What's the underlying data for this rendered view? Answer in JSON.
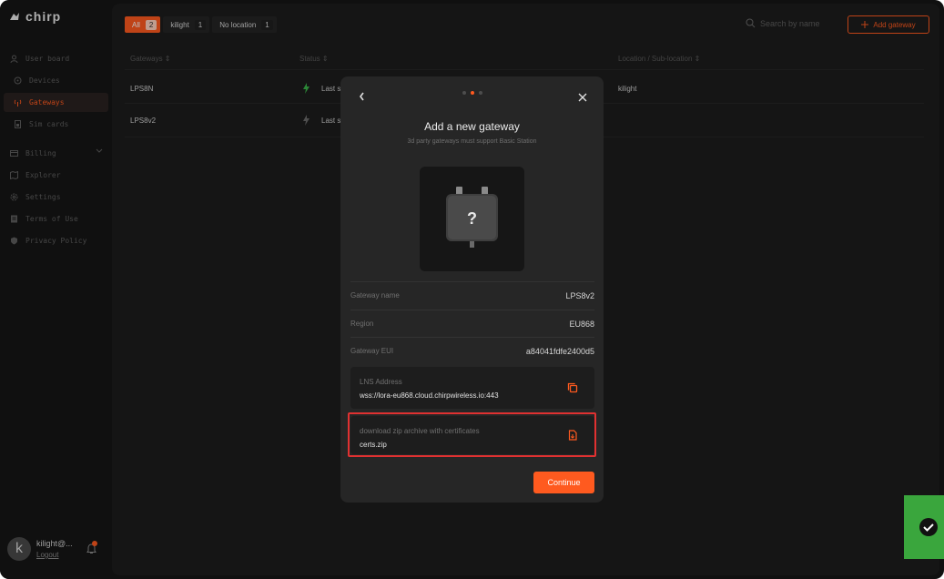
{
  "app": {
    "logo_text": "chirp"
  },
  "sidebar": {
    "items": [
      {
        "label": "User board",
        "icon": "user-icon"
      },
      {
        "label": "Devices",
        "icon": "devices-icon"
      },
      {
        "label": "Gateways",
        "icon": "gateway-icon",
        "active": true
      },
      {
        "label": "Sim cards",
        "icon": "sim-card-icon"
      },
      {
        "label": "Billing",
        "icon": "billing-icon"
      },
      {
        "label": "Explorer",
        "icon": "map-icon"
      },
      {
        "label": "Settings",
        "icon": "gear-icon"
      },
      {
        "label": "Terms of Use",
        "icon": "document-icon"
      },
      {
        "label": "Privacy Policy",
        "icon": "shield-icon"
      }
    ],
    "user": {
      "initial": "k",
      "name": "kilight@...",
      "logout": "Logout"
    }
  },
  "filters": [
    {
      "label": "All",
      "count": "2"
    },
    {
      "label": "kilight",
      "count": "1"
    },
    {
      "label": "No location",
      "count": "1"
    }
  ],
  "search": {
    "placeholder": "Search by name"
  },
  "add_gateway": "Add gateway",
  "table": {
    "columns": [
      "Gateways ⇕",
      "Status ⇕",
      "Location / Sub-location ⇕"
    ],
    "rows": [
      {
        "name": "LPS8N",
        "status": "Last s",
        "location": "kilight"
      },
      {
        "name": "LPS8v2",
        "status": "Last s",
        "location": ""
      }
    ]
  },
  "modal": {
    "title": "Add a new gateway",
    "subtitle": "3d party gateways must support Basic Station",
    "device_glyph": "?",
    "fields": [
      {
        "label": "Gateway name",
        "value": "LPS8v2"
      },
      {
        "label": "Region",
        "value": "EU868"
      },
      {
        "label": "Gateway EUI",
        "value": "a84041fdfe2400d5"
      }
    ],
    "lns": {
      "label": "LNS Address",
      "value": "wss://lora-eu868.cloud.chirpwireless.io:443"
    },
    "zip": {
      "label": "download zip archive with certificates",
      "value": "certs.zip"
    },
    "continue": "Continue"
  },
  "colors": {
    "accent": "#ff5a1f",
    "toast": "#3aa63d",
    "highlight": "#e03131"
  }
}
